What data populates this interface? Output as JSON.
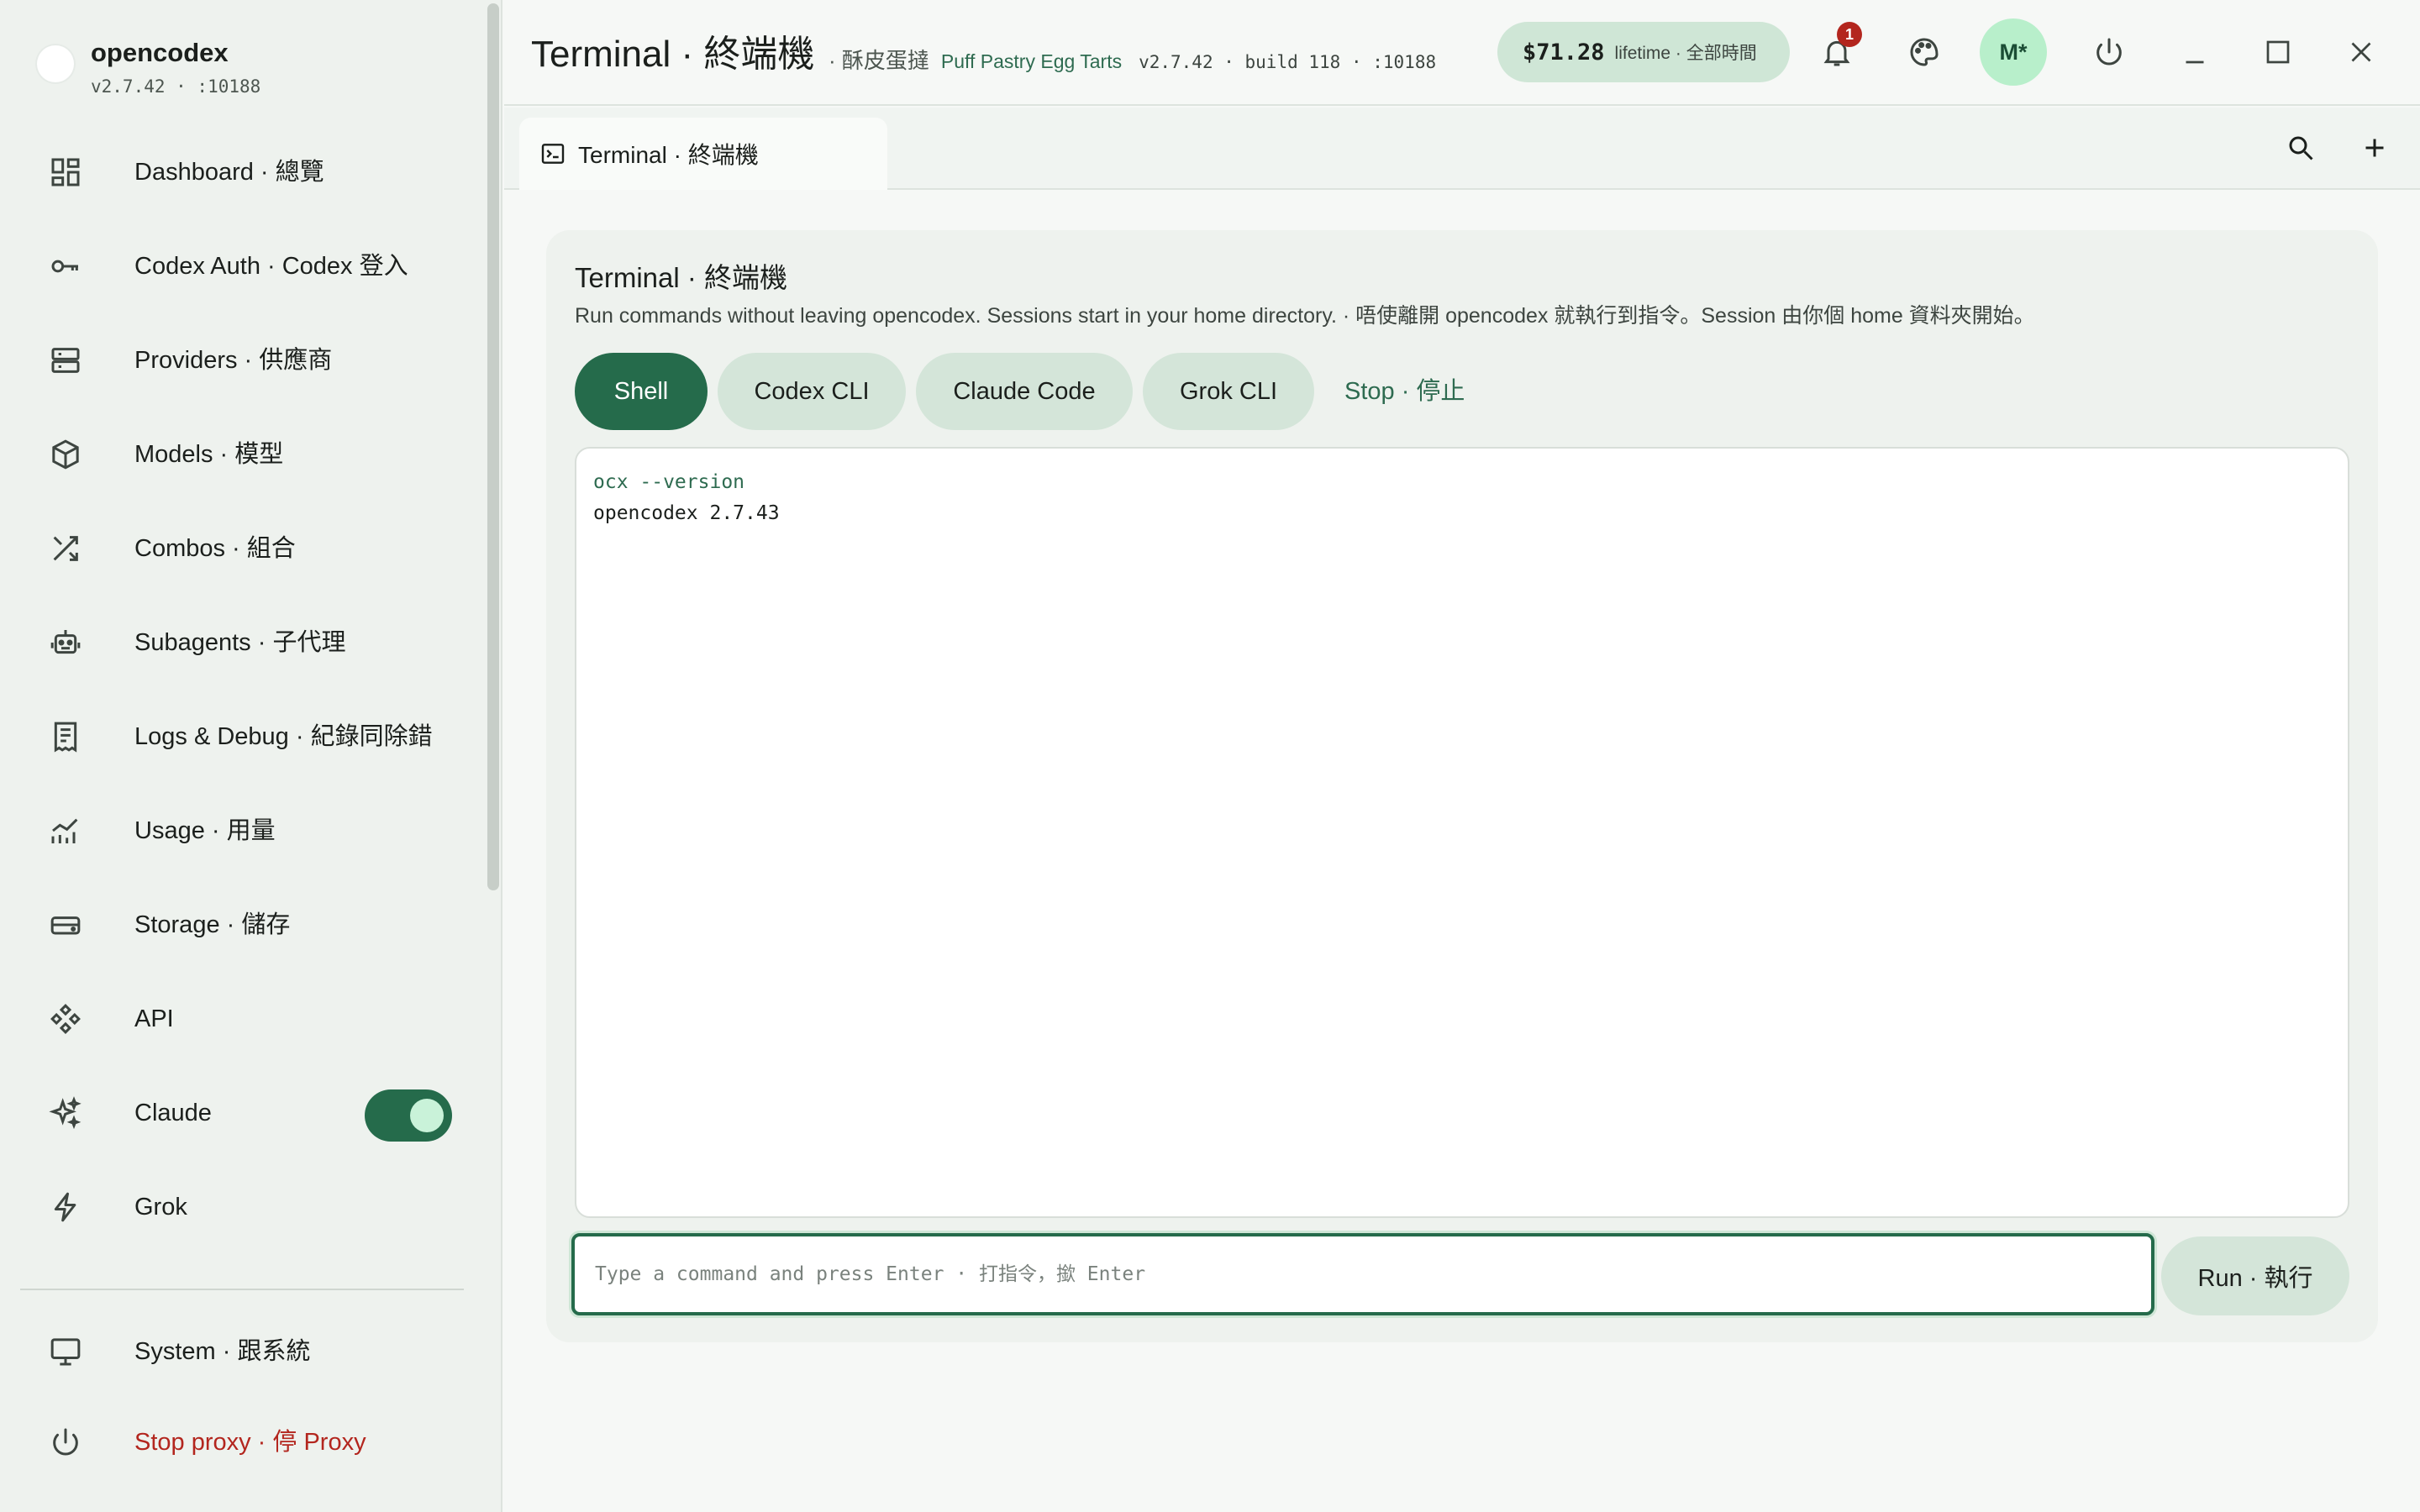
{
  "app": {
    "name": "opencodex",
    "sub": "v2.7.42 · :10188"
  },
  "sidebar": {
    "items": [
      {
        "label": "Dashboard · 總覽",
        "icon": "dashboard-icon"
      },
      {
        "label": "Codex Auth · Codex 登入",
        "icon": "key-icon"
      },
      {
        "label": "Providers · 供應商",
        "icon": "server-icon"
      },
      {
        "label": "Models · 模型",
        "icon": "cube-icon"
      },
      {
        "label": "Combos · 組合",
        "icon": "shuffle-icon"
      },
      {
        "label": "Subagents · 子代理",
        "icon": "robot-icon"
      },
      {
        "label": "Logs & Debug · 紀錄同除錯",
        "icon": "receipt-icon"
      },
      {
        "label": "Usage · 用量",
        "icon": "chart-icon"
      },
      {
        "label": "Storage · 儲存",
        "icon": "drive-icon"
      },
      {
        "label": "API",
        "icon": "api-icon"
      },
      {
        "label": "Claude",
        "icon": "sparkle-icon",
        "toggle_on": true
      },
      {
        "label": "Grok",
        "icon": "bolt-icon"
      }
    ],
    "bottom": [
      {
        "label": "System · 跟系統",
        "icon": "monitor-icon"
      },
      {
        "label": "Stop proxy · 停 Proxy",
        "icon": "power-icon"
      }
    ]
  },
  "header": {
    "title": "Terminal · 終端機",
    "subtitle_zh": "· 酥皮蛋撻",
    "subtitle_en": "Puff Pastry Egg Tarts",
    "build": "v2.7.42 · build 118 · :10188",
    "cost_amount": "$71.28",
    "cost_label": "lifetime · 全部時間",
    "notification_count": "1",
    "avatar": "M*"
  },
  "tabs": {
    "active": "Terminal · 終端機"
  },
  "terminal": {
    "title": "Terminal · 終端機",
    "description": "Run commands without leaving opencodex. Sessions start in your home directory. · 唔使離開 opencodex 就執行到指令。Session 由你個 home 資料夾開始。",
    "modes": [
      "Shell",
      "Codex CLI",
      "Claude Code",
      "Grok CLI"
    ],
    "active_mode": "Shell",
    "stop_label": "Stop · 停止",
    "output": [
      {
        "kind": "cmd",
        "text": "ocx --version"
      },
      {
        "kind": "out",
        "text": "opencodex 2.7.43"
      }
    ],
    "input_placeholder": "Type a command and press Enter · 打指令，撳 Enter",
    "input_value": "",
    "run_label": "Run · 執行"
  },
  "colors": {
    "accent": "#256b4b",
    "accent_soft": "#d4e5d9",
    "danger": "#b3261e",
    "avatar_bg": "#b8efcb"
  }
}
